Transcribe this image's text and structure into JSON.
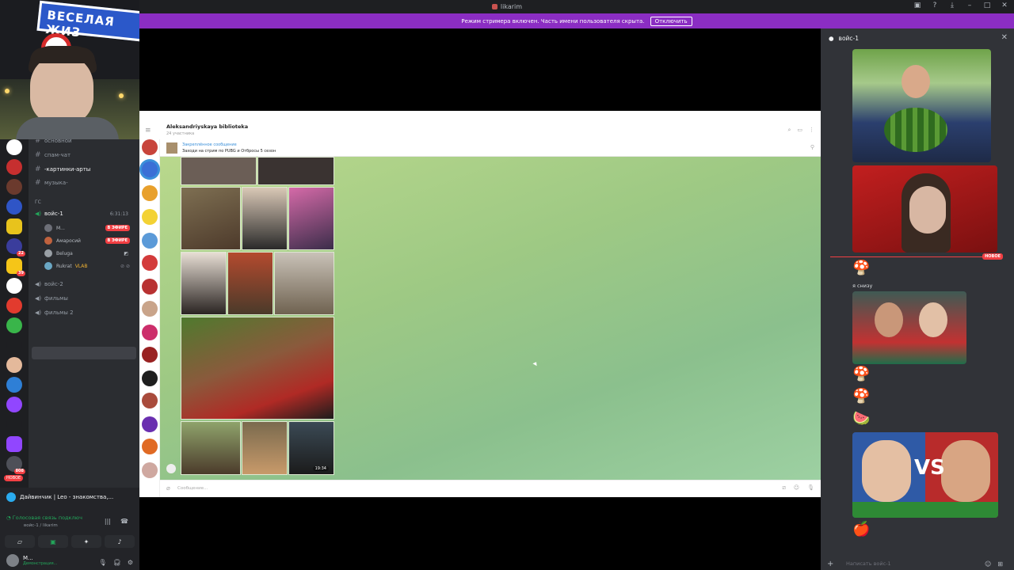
{
  "window": {
    "title": "likarim"
  },
  "banner": {
    "text": "Режим стримера включен. Часть имени пользователя скрыта.",
    "button": "Отключить"
  },
  "webcam": {
    "sign_text": "ВЕСЕЛАЯ ЖИЗ"
  },
  "servers": [
    {
      "badge": ""
    },
    {
      "badge": ""
    },
    {
      "badge": ""
    },
    {
      "badge": ""
    },
    {
      "badge": ""
    },
    {
      "badge": "22"
    },
    {
      "badge": "39"
    },
    {
      "badge": ""
    },
    {
      "badge": ""
    },
    {
      "badge": ""
    },
    {
      "badge": ""
    },
    {
      "badge": ""
    },
    {
      "badge": ""
    },
    {
      "badge": ""
    },
    {
      "badge": ""
    },
    {
      "badge": ""
    },
    {
      "badge": "808"
    }
  ],
  "server_new_label": "НОВОЕ",
  "channels": {
    "text": [
      {
        "label": "основной"
      },
      {
        "label": "спам-чат"
      },
      {
        "label": "-картинки-арты"
      },
      {
        "label": "музыка-"
      }
    ],
    "section": "ГС",
    "voice_active": {
      "label": "войс-1",
      "time": "6:31:13"
    },
    "members": [
      {
        "name": "М...",
        "live": "В ЭФИРЕ"
      },
      {
        "name": "Амаросий",
        "live": "В ЭФИРЕ"
      },
      {
        "name": "Beluga",
        "live": ""
      },
      {
        "name": "Rukrat",
        "tag": "VLAB",
        "live": ""
      }
    ],
    "voice_other": [
      {
        "label": "войс-2"
      },
      {
        "label": "фильмы"
      },
      {
        "label": "фильмы 2"
      }
    ]
  },
  "bottom": {
    "activity": "Дайвинчик | Leo - знакомства,...",
    "voice_status": "Голосовая связь подключ",
    "voice_sub": "войс-1 / likarim",
    "user_name": "М...",
    "user_status": "Демонстрация..."
  },
  "telegram": {
    "title": "Aleksandriyskaya biblioteka",
    "subtitle": "24 участника",
    "pinned_label": "Закреплённое сообщение",
    "pinned_text": "Заходи на стрим по PUBG и Отбросы 5 сезон",
    "msg_time": "19:34",
    "input_placeholder": "Сообщение..."
  },
  "right_panel": {
    "channel": "войс-1",
    "new_tag": "НОВОЕ",
    "message": "я снизу",
    "vs_text": "VS",
    "input_placeholder": "Написать войс-1"
  },
  "colors": {
    "banner": "#8b2dc3",
    "live": "#f23f43",
    "online": "#23a55a",
    "discord_bg": "#313338"
  }
}
